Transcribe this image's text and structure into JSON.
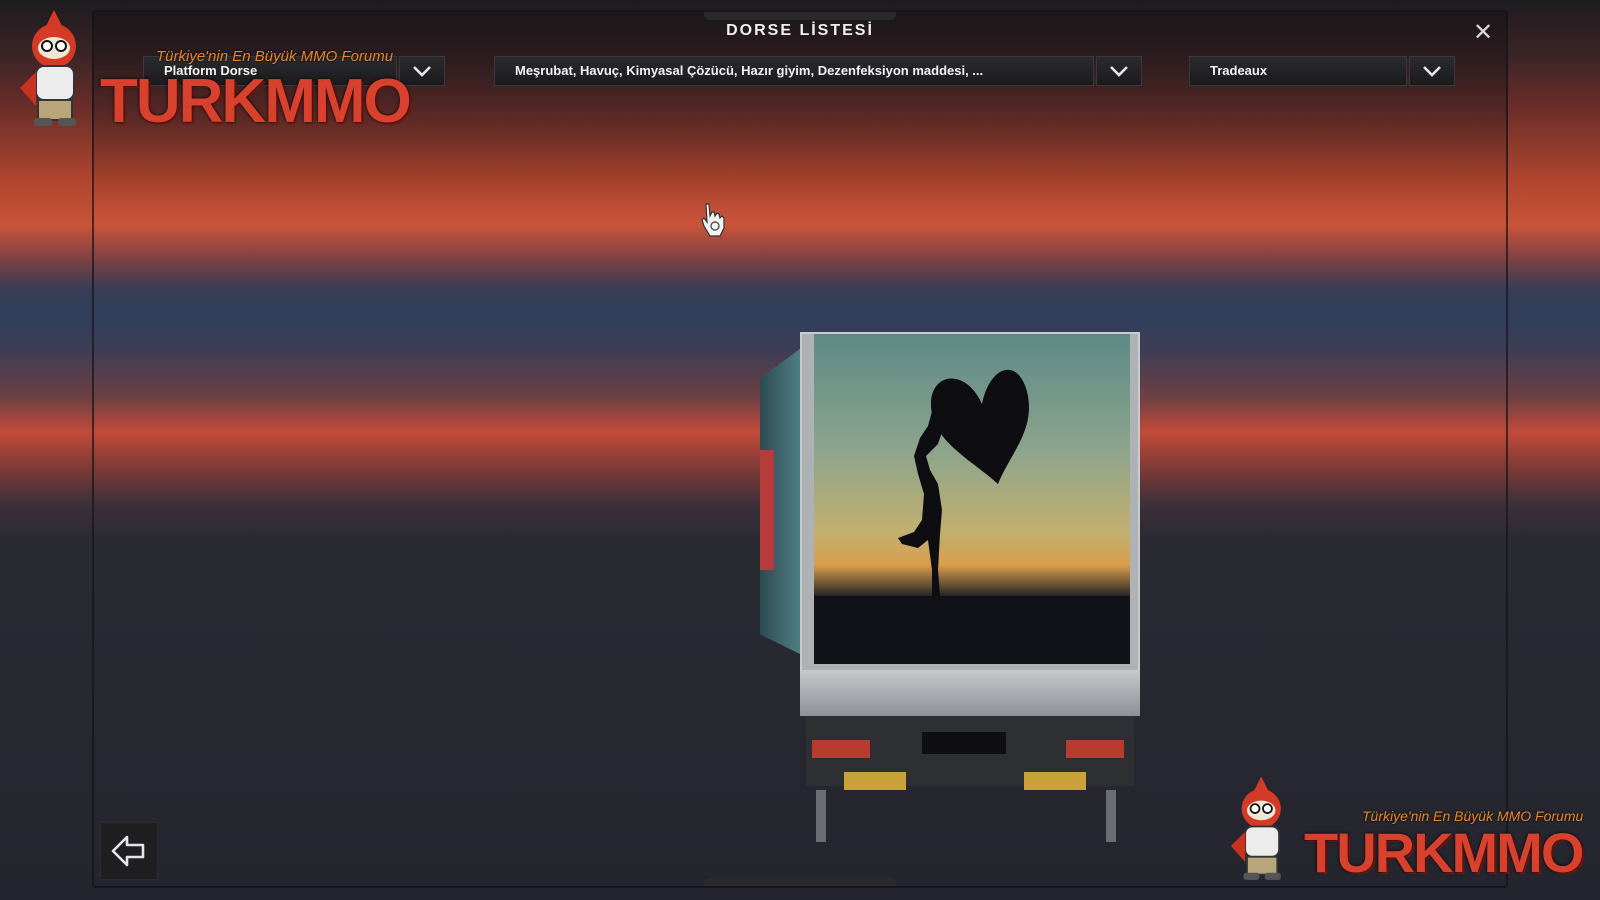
{
  "window": {
    "title": "DORSE LİSTESİ",
    "close_label": "✕"
  },
  "filters": {
    "trailer_type": {
      "value": "Platform Dorse"
    },
    "cargo": {
      "value": "Meşrubat, Havuç, Kimyasal Çözücü, Hazır giyim, Dezenfeksiyon maddesi, ..."
    },
    "company": {
      "value": "Tradeaux"
    }
  },
  "watermark": {
    "slogan": "Türkiye'nin En Büyük MMO Forumu",
    "brand": "TURKMMO"
  },
  "icons": {
    "close": "close-icon",
    "dropdown": "chevron-down-icon",
    "back": "arrow-left-icon",
    "cursor": "hand-cursor-icon"
  },
  "colors": {
    "accent_red": "#d8412d",
    "panel_dark": "#1b1b1e",
    "text": "#f2f2f2"
  }
}
